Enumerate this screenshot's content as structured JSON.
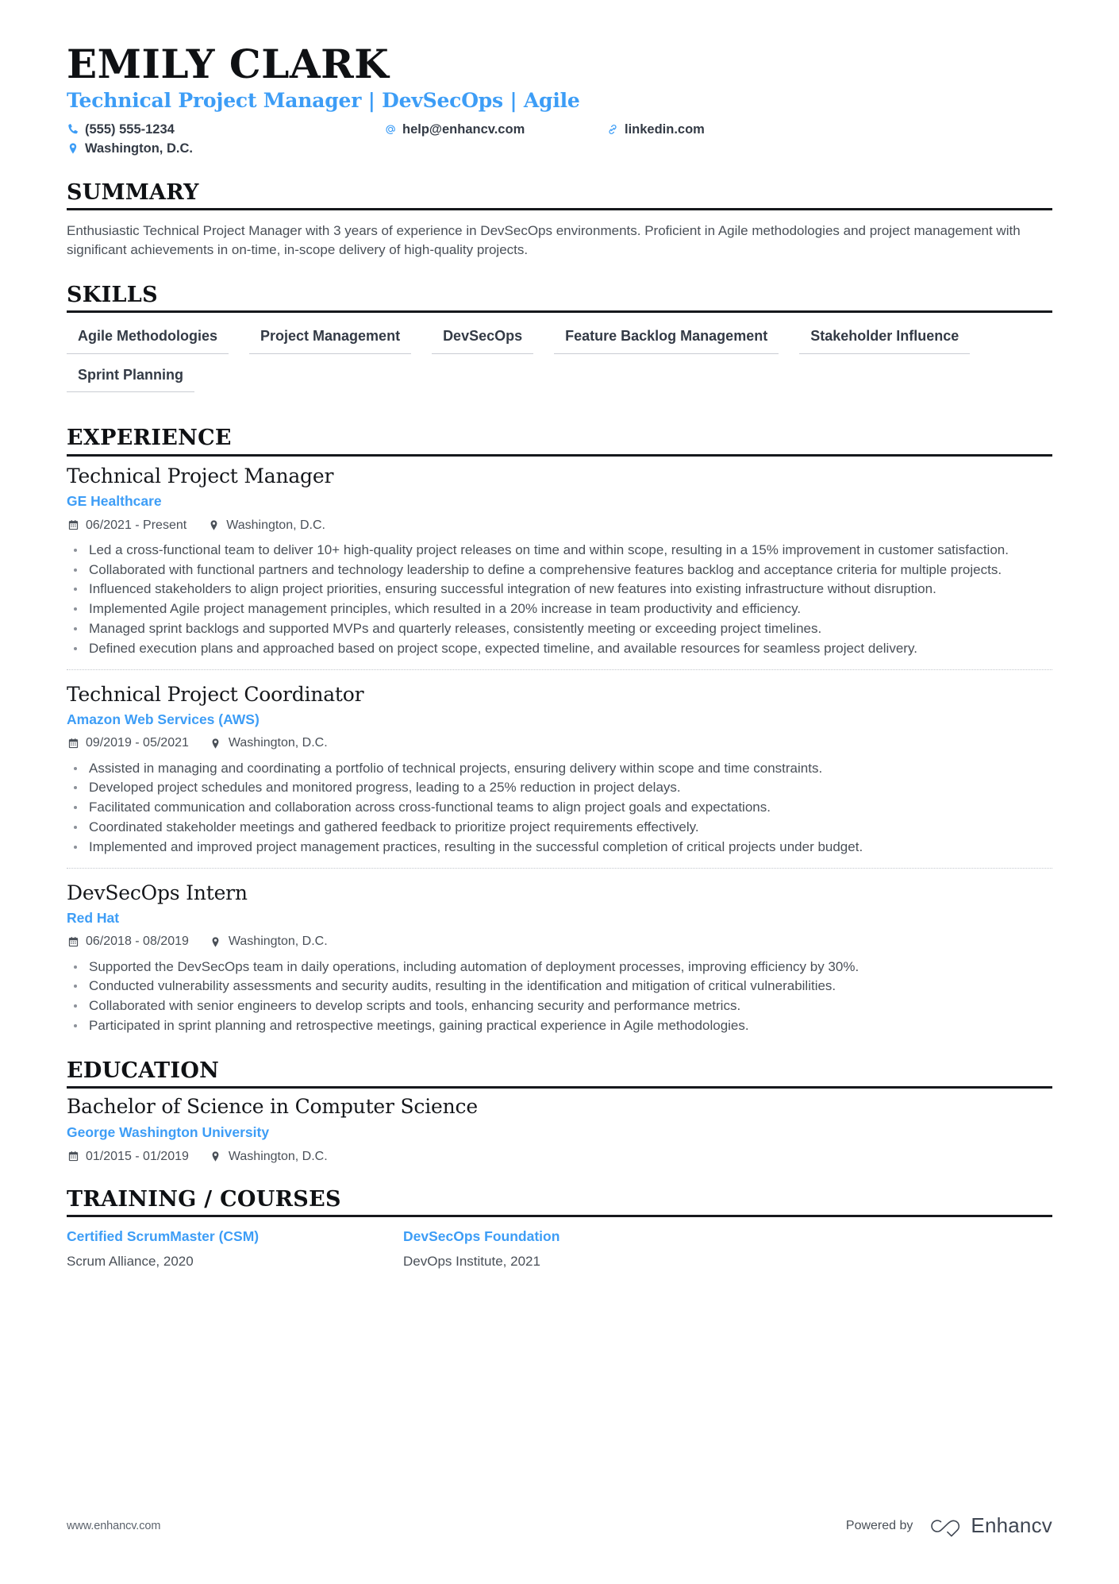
{
  "header": {
    "name": "EMILY CLARK",
    "headline": "Technical Project Manager | DevSecOps | Agile",
    "accent_color": "#3d9df6",
    "contacts": [
      {
        "icon": "phone-icon",
        "text": "(555) 555-1234"
      },
      {
        "icon": "email-at-icon",
        "text": "help@enhancv.com"
      },
      {
        "icon": "link-icon",
        "text": "linkedin.com"
      },
      {
        "icon": "location-pin-icon",
        "text": "Washington, D.C."
      }
    ]
  },
  "summary": {
    "title": "SUMMARY",
    "text": "Enthusiastic Technical Project Manager with 3 years of experience in DevSecOps environments. Proficient in Agile methodologies and project management with significant achievements in on-time, in-scope delivery of high-quality projects."
  },
  "skills": {
    "title": "SKILLS",
    "items": [
      "Agile Methodologies",
      "Project Management",
      "DevSecOps",
      "Feature Backlog Management",
      "Stakeholder Influence",
      "Sprint Planning"
    ]
  },
  "experience": {
    "title": "EXPERIENCE",
    "jobs": [
      {
        "title": "Technical Project Manager",
        "company": "GE Healthcare",
        "dates": "06/2021 - Present",
        "location": "Washington, D.C.",
        "bullets": [
          "Led a cross-functional team to deliver 10+ high-quality project releases on time and within scope, resulting in a 15% improvement in customer satisfaction.",
          "Collaborated with functional partners and technology leadership to define a comprehensive features backlog and acceptance criteria for multiple projects.",
          "Influenced stakeholders to align project priorities, ensuring successful integration of new features into existing infrastructure without disruption.",
          "Implemented Agile project management principles, which resulted in a 20% increase in team productivity and efficiency.",
          "Managed sprint backlogs and supported MVPs and quarterly releases, consistently meeting or exceeding project timelines.",
          "Defined execution plans and approached based on project scope, expected timeline, and available resources for seamless project delivery."
        ]
      },
      {
        "title": "Technical Project Coordinator",
        "company": "Amazon Web Services (AWS)",
        "dates": "09/2019 - 05/2021",
        "location": "Washington, D.C.",
        "bullets": [
          "Assisted in managing and coordinating a portfolio of technical projects, ensuring delivery within scope and time constraints.",
          "Developed project schedules and monitored progress, leading to a 25% reduction in project delays.",
          "Facilitated communication and collaboration across cross-functional teams to align project goals and expectations.",
          "Coordinated stakeholder meetings and gathered feedback to prioritize project requirements effectively.",
          "Implemented and improved project management practices, resulting in the successful completion of critical projects under budget."
        ]
      },
      {
        "title": "DevSecOps Intern",
        "company": "Red Hat",
        "dates": "06/2018 - 08/2019",
        "location": "Washington, D.C.",
        "bullets": [
          "Supported the DevSecOps team in daily operations, including automation of deployment processes, improving efficiency by 30%.",
          "Conducted vulnerability assessments and security audits, resulting in the identification and mitigation of critical vulnerabilities.",
          "Collaborated with senior engineers to develop scripts and tools, enhancing security and performance metrics.",
          "Participated in sprint planning and retrospective meetings, gaining practical experience in Agile methodologies."
        ]
      }
    ]
  },
  "education": {
    "title": "EDUCATION",
    "entries": [
      {
        "degree": "Bachelor of Science in Computer Science",
        "school": "George Washington University",
        "dates": "01/2015 - 01/2019",
        "location": "Washington, D.C."
      }
    ]
  },
  "training": {
    "title": "TRAINING / COURSES",
    "courses": [
      {
        "name": "Certified ScrumMaster (CSM)",
        "org": "Scrum Alliance, 2020"
      },
      {
        "name": "DevSecOps Foundation",
        "org": "DevOps Institute, 2021"
      }
    ]
  },
  "footer": {
    "url": "www.enhancv.com",
    "powered_by": "Powered by",
    "brand": "Enhancv"
  }
}
